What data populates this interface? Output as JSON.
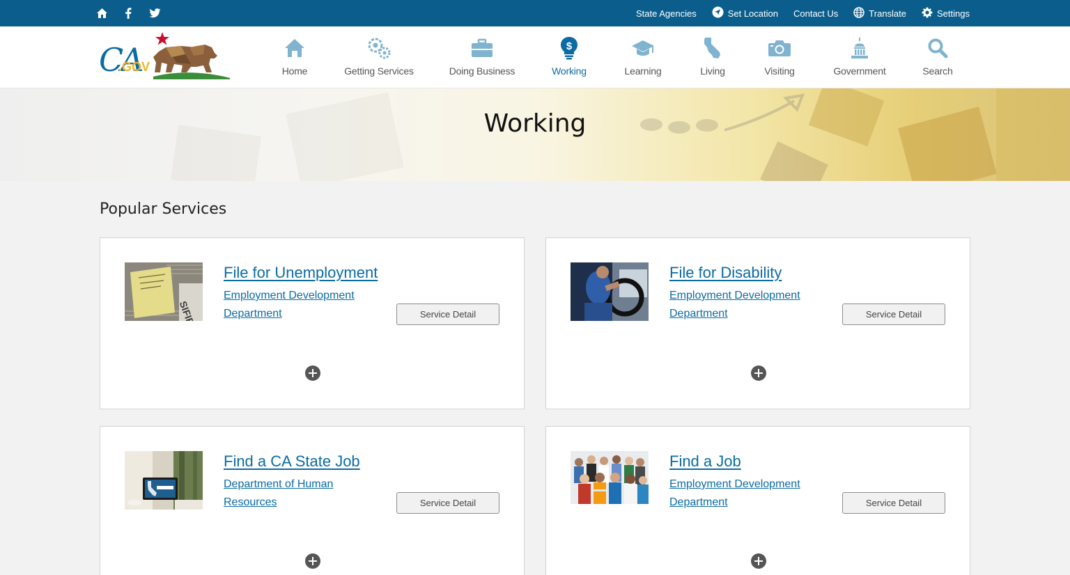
{
  "utility_bar": {
    "left_icons": [
      "home-icon",
      "facebook-icon",
      "twitter-icon"
    ],
    "links": [
      {
        "label": "State Agencies",
        "icon": ""
      },
      {
        "label": "Set Location",
        "icon": "location-icon"
      },
      {
        "label": "Contact Us",
        "icon": ""
      },
      {
        "label": "Translate",
        "icon": "globe-icon"
      },
      {
        "label": "Settings",
        "icon": "gear-icon"
      }
    ]
  },
  "header": {
    "logo_text": "CA.GOV",
    "nav": [
      {
        "label": "Home",
        "icon": "house-icon",
        "active": false
      },
      {
        "label": "Getting Services",
        "icon": "gears-icon",
        "active": false
      },
      {
        "label": "Doing Business",
        "icon": "briefcase-icon",
        "active": false
      },
      {
        "label": "Working",
        "icon": "lightbulb-dollar-icon",
        "active": true
      },
      {
        "label": "Learning",
        "icon": "graduation-cap-icon",
        "active": false
      },
      {
        "label": "Living",
        "icon": "california-icon",
        "active": false
      },
      {
        "label": "Visiting",
        "icon": "camera-icon",
        "active": false
      },
      {
        "label": "Government",
        "icon": "capitol-icon",
        "active": false
      },
      {
        "label": "Search",
        "icon": "search-icon",
        "active": false
      }
    ]
  },
  "banner": {
    "title": "Working"
  },
  "popular": {
    "title": "Popular Services",
    "cards": [
      {
        "title": "File for Unemployment",
        "dept": "Employment Development Department",
        "button": "Service Detail"
      },
      {
        "title": "File for Disability",
        "dept": "Employment Development Department",
        "button": "Service Detail"
      },
      {
        "title": "Find a CA State Job",
        "dept": "Department of Human Resources",
        "button": "Service Detail"
      },
      {
        "title": "Find a Job",
        "dept": "Employment Development Department",
        "button": "Service Detail"
      }
    ]
  },
  "colors": {
    "utility_bg": "#0b5e8c",
    "accent": "#0b6ba3",
    "nav_icon": "#7fb3cf"
  }
}
